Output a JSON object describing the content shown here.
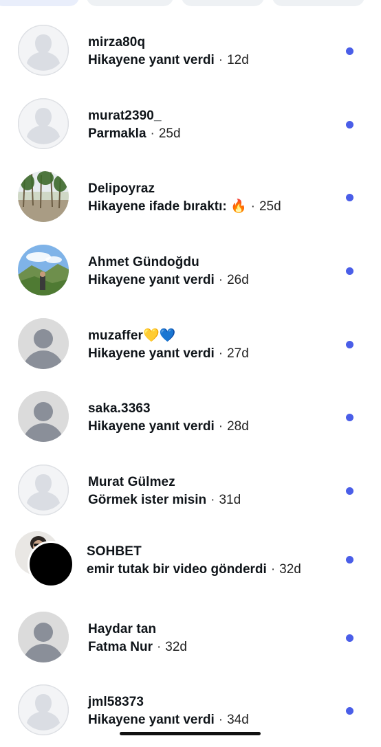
{
  "chats": [
    {
      "name": "mirza80q",
      "message": "Hikayene yanıt verdi",
      "separator": "·",
      "time": "12d",
      "avatar": "ghost"
    },
    {
      "name": "murat2390_",
      "message": "Parmakla",
      "separator": "·",
      "time": "25d",
      "avatar": "ghost"
    },
    {
      "name": "Delipoyraz",
      "message": "Hikayene ifade bıraktı: 🔥",
      "separator": "·",
      "time": "25d",
      "avatar": "forest-photo"
    },
    {
      "name": "Ahmet Gündoğdu",
      "message": "Hikayene yanıt verdi",
      "separator": "·",
      "time": "26d",
      "avatar": "mountain-photo"
    },
    {
      "name": "muzaffer💛💙",
      "message": "Hikayene yanıt verdi",
      "separator": "·",
      "time": "27d",
      "avatar": "default"
    },
    {
      "name": "saka.3363",
      "message": "Hikayene yanıt verdi",
      "separator": "·",
      "time": "28d",
      "avatar": "default"
    },
    {
      "name": "Murat Gülmez",
      "message": "Görmek ister misin",
      "separator": "·",
      "time": "31d",
      "avatar": "ghost"
    },
    {
      "name": "SOHBET",
      "message": "emir tutak bir video gönderdi",
      "separator": "·",
      "time": "32d",
      "avatar": "group"
    },
    {
      "name": "Haydar tan",
      "message": "Fatma Nur",
      "separator": "·",
      "time": "32d",
      "avatar": "default"
    },
    {
      "name": "jml58373",
      "message": "Hikayene yanıt verdi",
      "separator": "·",
      "time": "34d",
      "avatar": "ghost"
    }
  ],
  "colors": {
    "unread_dot": "#4a5ee8",
    "background": "#ffffff"
  }
}
